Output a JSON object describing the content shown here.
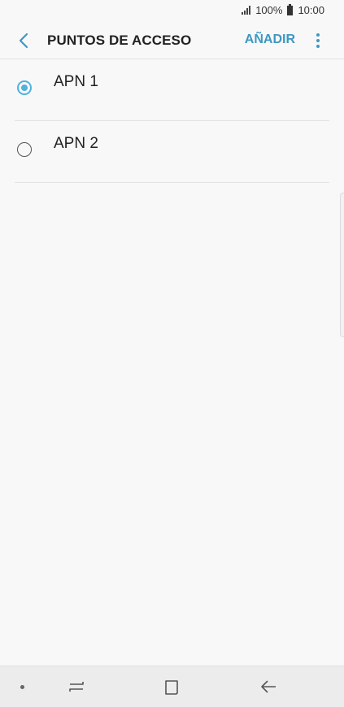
{
  "status_bar": {
    "battery": "100%",
    "time": "10:00",
    "icons": [
      "signal-icon",
      "battery-icon"
    ]
  },
  "header": {
    "title": "PUNTOS DE ACCESO",
    "add_label": "AÑADIR",
    "icons": [
      "back-icon",
      "more-options-icon"
    ]
  },
  "apn_list": {
    "items": [
      {
        "label": "APN 1",
        "selected": true
      },
      {
        "label": "APN 2",
        "selected": false
      }
    ]
  },
  "nav_bar": {
    "icons": [
      "nav-dot-icon",
      "recent-apps-icon",
      "home-icon",
      "back-arrow-icon"
    ]
  },
  "colors": {
    "accent": "#3e98c2",
    "radio_selected": "#4fb3dc",
    "background": "#f8f8f8",
    "nav_background": "#ececec"
  }
}
